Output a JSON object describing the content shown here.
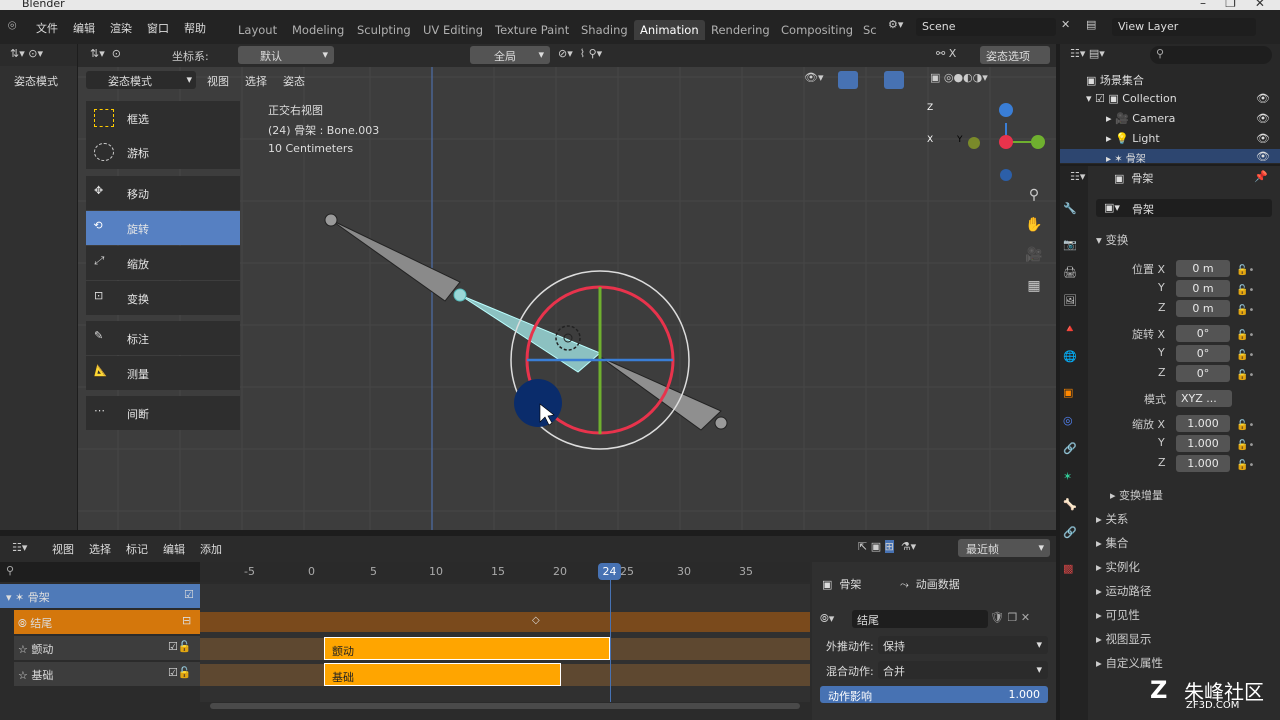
{
  "app": {
    "title": "Blender"
  },
  "menu": {
    "items": [
      "文件",
      "编辑",
      "渲染",
      "窗口",
      "帮助"
    ]
  },
  "workspaces": {
    "tabs": [
      "Layout",
      "Modeling",
      "Sculpting",
      "UV Editing",
      "Texture Paint",
      "Shading",
      "Animation",
      "Rendering",
      "Compositing",
      "Sc"
    ],
    "active": "Animation"
  },
  "scene": {
    "name": "Scene",
    "view_layer": "View Layer"
  },
  "viewport_header": {
    "coord_label": "坐标系:",
    "coord_value": "默认",
    "pivot_value": "全局",
    "pose_options": "姿态选项"
  },
  "viewport_menu": {
    "mode": "姿态模式",
    "items": [
      "视图",
      "选择",
      "姿态"
    ],
    "mode_left": "姿态模式"
  },
  "viewport_info": {
    "line1": "正交右视图",
    "line2": "(24) 骨架 : Bone.003",
    "line3": "10 Centimeters"
  },
  "tools": [
    {
      "label": "框选",
      "active": false
    },
    {
      "label": "游标",
      "active": false
    },
    {
      "label": "移动",
      "active": false
    },
    {
      "label": "旋转",
      "active": true
    },
    {
      "label": "缩放",
      "active": false
    },
    {
      "label": "变换",
      "active": false
    },
    {
      "label": "标注",
      "active": false
    },
    {
      "label": "测量",
      "active": false
    },
    {
      "label": "间断",
      "active": false
    }
  ],
  "outliner": {
    "root": "场景集合",
    "items": [
      {
        "label": "Collection"
      },
      {
        "label": "Camera"
      },
      {
        "label": "Light"
      },
      {
        "label": "骨架"
      }
    ]
  },
  "properties": {
    "header": "骨架",
    "object_name": "骨架",
    "transform_label": "变换",
    "location": {
      "label": "位置",
      "x": "0 m",
      "y": "0 m",
      "z": "0 m"
    },
    "rotation": {
      "label": "旋转",
      "x": "0°",
      "y": "0°",
      "z": "0°"
    },
    "mode": {
      "label": "模式",
      "value": "XYZ ..."
    },
    "scale": {
      "label": "缩放",
      "x": "1.000",
      "y": "1.000",
      "z": "1.000"
    },
    "axis_x": "X",
    "axis_y": "Y",
    "axis_z": "Z",
    "delta": "变换增量",
    "sections": [
      "关系",
      "集合",
      "实例化",
      "运动路径",
      "可见性",
      "视图显示",
      "自定义属性"
    ]
  },
  "nla": {
    "menu": [
      "视图",
      "选择",
      "标记",
      "编辑",
      "添加"
    ],
    "snap": "最近帧",
    "ruler": [
      "-5",
      "0",
      "5",
      "10",
      "15",
      "20",
      "24",
      "25",
      "30",
      "35"
    ],
    "current_frame": "24",
    "tracks": [
      {
        "label": "骨架"
      },
      {
        "label": "结尾"
      },
      {
        "label": "颤动"
      },
      {
        "label": "基础"
      }
    ],
    "strips": [
      {
        "label": "颤动"
      },
      {
        "label": "基础"
      }
    ]
  },
  "strip_panel": {
    "tab1": "骨架",
    "tab2": "动画数据",
    "action": "结尾",
    "extrapolation_label": "外推动作:",
    "extrapolation": "保持",
    "blend_label": "混合动作:",
    "blend": "合并",
    "influence_label": "动作影响",
    "influence": "1.000"
  },
  "gizmo": {
    "x": "X",
    "y": "Y",
    "z": "Z"
  },
  "watermark": {
    "text": "朱峰社区",
    "url": "ZF3D.COM"
  },
  "colors": {
    "accent": "#5680c2",
    "nla_strip": "#ffa500",
    "track_orange": "#d4770c",
    "track_blue": "#4f7ab8"
  }
}
